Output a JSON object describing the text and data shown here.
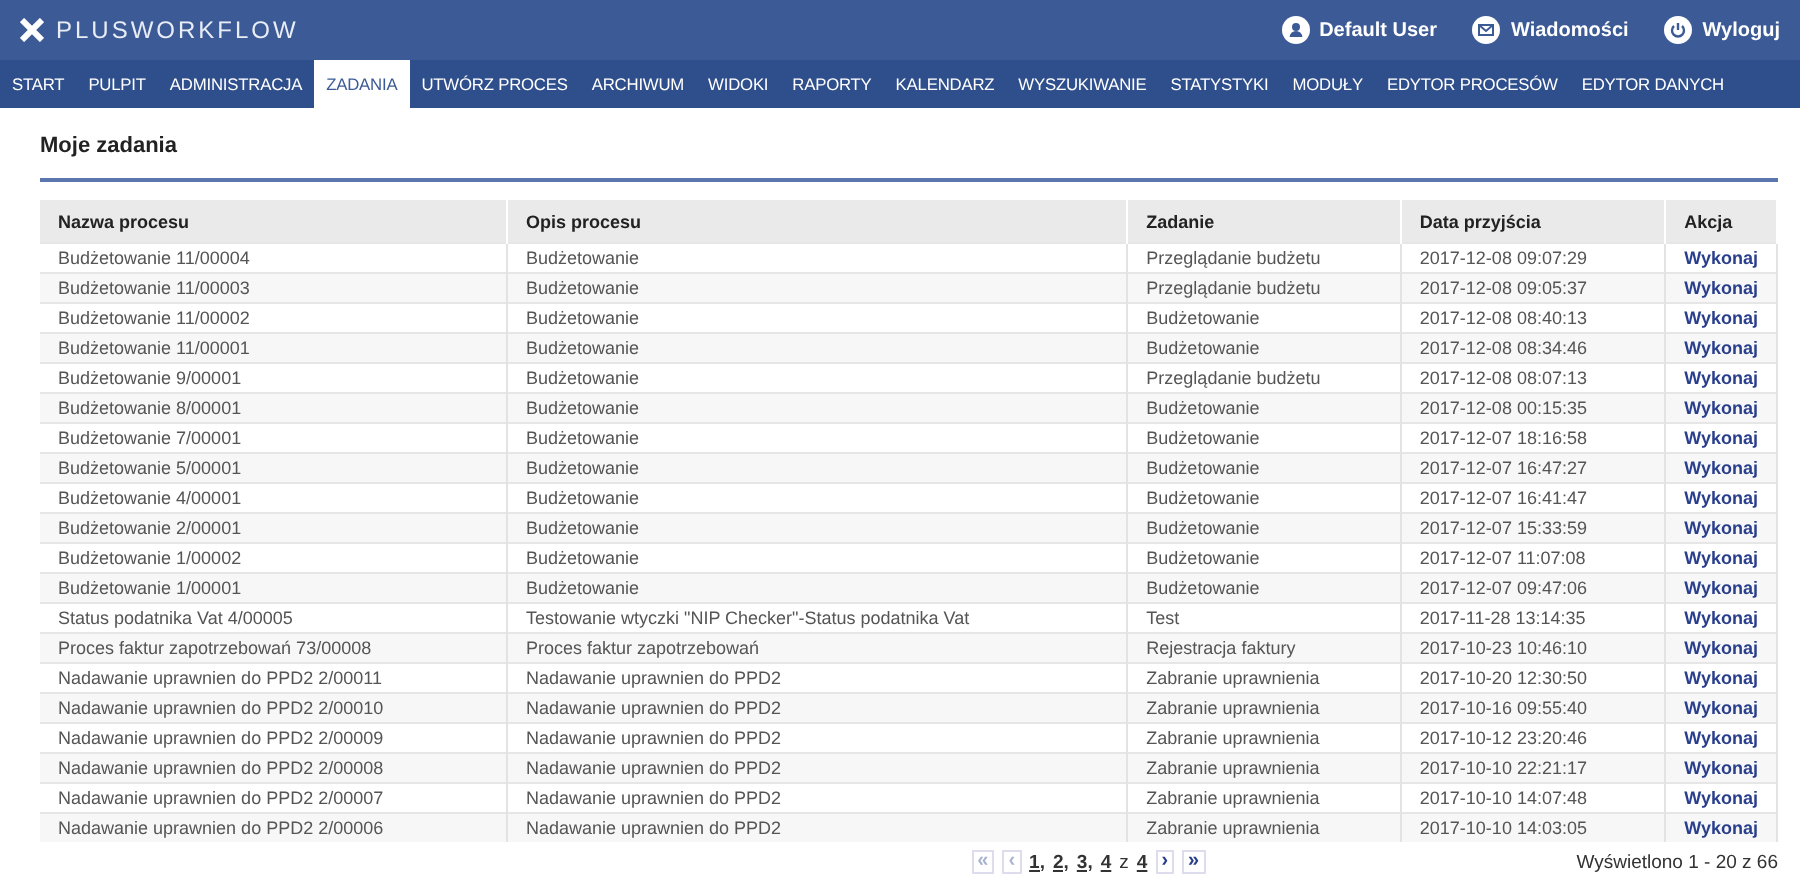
{
  "header": {
    "logo": "PLUSWORKFLOW",
    "user_links": [
      {
        "kind": "user",
        "label": "Default User"
      },
      {
        "kind": "messages",
        "label": "Wiadomości"
      },
      {
        "kind": "logout",
        "label": "Wyloguj"
      }
    ]
  },
  "nav": [
    {
      "label": "START",
      "selected": false
    },
    {
      "label": "PULPIT",
      "selected": false
    },
    {
      "label": "ADMINISTRACJA",
      "selected": false
    },
    {
      "label": "ZADANIA",
      "selected": true
    },
    {
      "label": "UTWÓRZ PROCES",
      "selected": false
    },
    {
      "label": "ARCHIWUM",
      "selected": false
    },
    {
      "label": "WIDOKI",
      "selected": false
    },
    {
      "label": "RAPORTY",
      "selected": false
    },
    {
      "label": "KALENDARZ",
      "selected": false
    },
    {
      "label": "WYSZUKIWANIE",
      "selected": false
    },
    {
      "label": "STATYSTYKI",
      "selected": false
    },
    {
      "label": "MODUŁY",
      "selected": false
    },
    {
      "label": "EDYTOR PROCESÓW",
      "selected": false
    },
    {
      "label": "EDYTOR DANYCH",
      "selected": false
    }
  ],
  "page_title": "Moje zadania",
  "table": {
    "columns": [
      "Nazwa procesu",
      "Opis procesu",
      "Zadanie",
      "Data przyjścia",
      "Akcja"
    ],
    "rows": [
      [
        "Budżetowanie 11/00004",
        "Budżetowanie",
        "Przeglądanie budżetu",
        "2017-12-08 09:07:29",
        "Wykonaj"
      ],
      [
        "Budżetowanie 11/00003",
        "Budżetowanie",
        "Przeglądanie budżetu",
        "2017-12-08 09:05:37",
        "Wykonaj"
      ],
      [
        "Budżetowanie 11/00002",
        "Budżetowanie",
        "Budżetowanie",
        "2017-12-08 08:40:13",
        "Wykonaj"
      ],
      [
        "Budżetowanie 11/00001",
        "Budżetowanie",
        "Budżetowanie",
        "2017-12-08 08:34:46",
        "Wykonaj"
      ],
      [
        "Budżetowanie 9/00001",
        "Budżetowanie",
        "Przeglądanie budżetu",
        "2017-12-08 08:07:13",
        "Wykonaj"
      ],
      [
        "Budżetowanie 8/00001",
        "Budżetowanie",
        "Budżetowanie",
        "2017-12-08 00:15:35",
        "Wykonaj"
      ],
      [
        "Budżetowanie 7/00001",
        "Budżetowanie",
        "Budżetowanie",
        "2017-12-07 18:16:58",
        "Wykonaj"
      ],
      [
        "Budżetowanie 5/00001",
        "Budżetowanie",
        "Budżetowanie",
        "2017-12-07 16:47:27",
        "Wykonaj"
      ],
      [
        "Budżetowanie 4/00001",
        "Budżetowanie",
        "Budżetowanie",
        "2017-12-07 16:41:47",
        "Wykonaj"
      ],
      [
        "Budżetowanie 2/00001",
        "Budżetowanie",
        "Budżetowanie",
        "2017-12-07 15:33:59",
        "Wykonaj"
      ],
      [
        "Budżetowanie 1/00002",
        "Budżetowanie",
        "Budżetowanie",
        "2017-12-07 11:07:08",
        "Wykonaj"
      ],
      [
        "Budżetowanie 1/00001",
        "Budżetowanie",
        "Budżetowanie",
        "2017-12-07 09:47:06",
        "Wykonaj"
      ],
      [
        "Status podatnika Vat 4/00005",
        "Testowanie wtyczki \"NIP Checker\"-Status podatnika Vat",
        "Test",
        "2017-11-28 13:14:35",
        "Wykonaj"
      ],
      [
        "Proces faktur zapotrzebowań 73/00008",
        "Proces faktur zapotrzebowań",
        "Rejestracja faktury",
        "2017-10-23 10:46:10",
        "Wykonaj"
      ],
      [
        "Nadawanie uprawnien do PPD2 2/00011",
        "Nadawanie uprawnien do PPD2",
        "Zabranie uprawnienia",
        "2017-10-20 12:30:50",
        "Wykonaj"
      ],
      [
        "Nadawanie uprawnien do PPD2 2/00010",
        "Nadawanie uprawnien do PPD2",
        "Zabranie uprawnienia",
        "2017-10-16 09:55:40",
        "Wykonaj"
      ],
      [
        "Nadawanie uprawnien do PPD2 2/00009",
        "Nadawanie uprawnien do PPD2",
        "Zabranie uprawnienia",
        "2017-10-12 23:20:46",
        "Wykonaj"
      ],
      [
        "Nadawanie uprawnien do PPD2 2/00008",
        "Nadawanie uprawnien do PPD2",
        "Zabranie uprawnienia",
        "2017-10-10 22:21:17",
        "Wykonaj"
      ],
      [
        "Nadawanie uprawnien do PPD2 2/00007",
        "Nadawanie uprawnien do PPD2",
        "Zabranie uprawnienia",
        "2017-10-10 14:07:48",
        "Wykonaj"
      ],
      [
        "Nadawanie uprawnien do PPD2 2/00006",
        "Nadawanie uprawnien do PPD2",
        "Zabranie uprawnienia",
        "2017-10-10 14:03:05",
        "Wykonaj"
      ]
    ]
  },
  "pagination": {
    "first": {
      "label": "«",
      "disabled": true
    },
    "prev": {
      "label": "‹",
      "disabled": true
    },
    "pages": [
      "1,",
      "2,",
      "3,",
      "4"
    ],
    "of": "z",
    "total": "4",
    "next": {
      "label": "›",
      "disabled": false
    },
    "last": {
      "label": "»",
      "disabled": false
    }
  },
  "summary": "Wyświetlono 1 - 20 z 66"
}
